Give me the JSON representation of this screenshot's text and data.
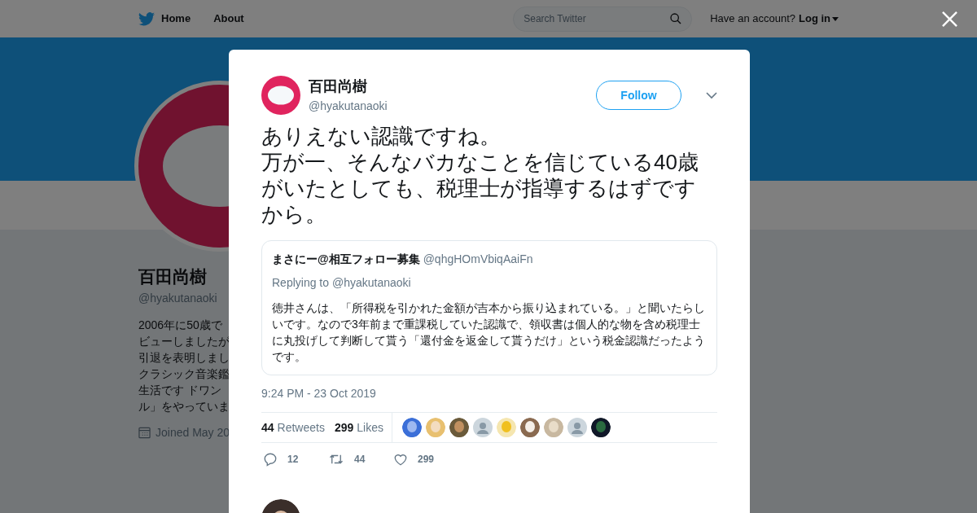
{
  "nav": {
    "items": [
      "Home",
      "About"
    ],
    "search": {
      "placeholder": "Search Twitter"
    },
    "account_prompt": "Have an account?",
    "login": "Log in"
  },
  "profile": {
    "name": "百田尚樹",
    "handle": "@hyakutanaoki",
    "bio_lines": [
      "2006年に50歳で",
      "ビューしましたが",
      "引退を表明しまし",
      "クラシック音楽鑑",
      "生活です ドワン",
      "ル」をやっていま"
    ],
    "joined": "Joined May 20"
  },
  "tweet": {
    "name": "百田尚樹",
    "handle": "@hyakutanaoki",
    "follow": "Follow",
    "paragraphs": [
      "ありえない認識ですね。",
      "万が一、そんなバカなことを信じている40歳がいたとしても、税理士が指導するはずですから。"
    ],
    "quote": {
      "name": "まさにー@相互フォロー募集",
      "handle": "@qhgHOmVbiqAaiFn",
      "replying": "Replying to @hyakutanaoki",
      "text": "徳井さんは、「所得税を引かれた金額が吉本から振り込まれている。」と聞いたらしいです。なので3年前まで重課税していた認識で、領収書は個人的な物を含め税理士に丸投げして判断して貰う「還付金を返金して貰うだけ」という税金認識だったようです。"
    },
    "time": "9:24 PM - 23 Oct 2019",
    "stats": [
      {
        "count": "44",
        "label": "Retweets"
      },
      {
        "count": "299",
        "label": "Likes"
      }
    ],
    "likers": [
      {
        "kind": "picture"
      },
      {
        "kind": "picture"
      },
      {
        "kind": "picture"
      },
      {
        "kind": "default"
      },
      {
        "kind": "picture"
      },
      {
        "kind": "picture"
      },
      {
        "kind": "picture"
      },
      {
        "kind": "default"
      },
      {
        "kind": "picture"
      }
    ],
    "actions": [
      {
        "kind": "reply",
        "count": "12"
      },
      {
        "kind": "retweet",
        "count": "44"
      },
      {
        "kind": "like",
        "count": "299"
      }
    ]
  }
}
